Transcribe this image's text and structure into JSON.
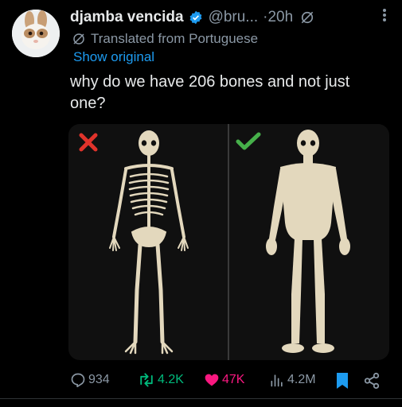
{
  "post": {
    "display_name": "djamba vencida",
    "handle": "@bru...",
    "separator": "·",
    "time": "20h",
    "translated_label": "Translated from Portuguese",
    "show_original": "Show original",
    "text": "why do we have 206 bones and not just one?"
  },
  "media": {
    "left_mark": "cross-icon",
    "right_mark": "check-icon",
    "colors": {
      "cross": "#e0332b",
      "check": "#46b04a",
      "bone": "#e3d8bd"
    }
  },
  "actions": {
    "replies": "934",
    "reposts": "4.2K",
    "likes": "47K",
    "views": "4.2M"
  },
  "colors": {
    "background": "#000000",
    "text": "#e7e9ea",
    "muted": "#8b98a5",
    "link": "#1d9bf0",
    "repost": "#00ba7c",
    "like": "#f91880",
    "bookmark": "#1d9bf0"
  }
}
